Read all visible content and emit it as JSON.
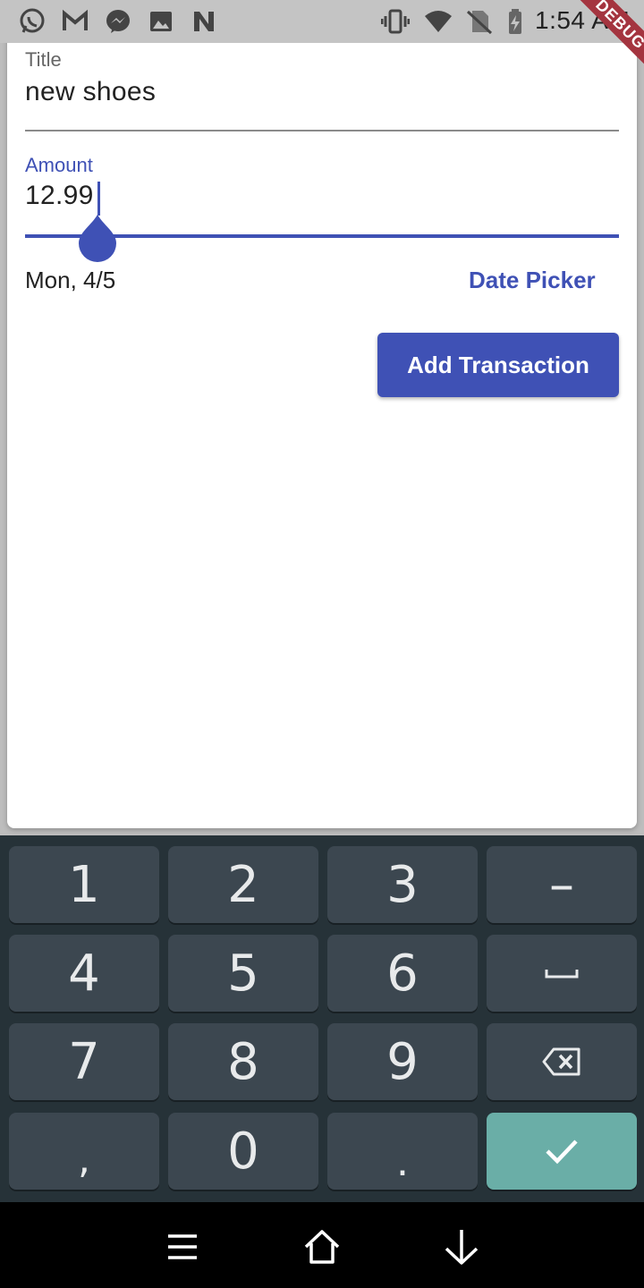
{
  "status_bar": {
    "icons": [
      "whatsapp-icon",
      "gmail-icon",
      "messenger-icon",
      "gallery-icon",
      "n-app-icon",
      "vibrate-icon",
      "wifi-icon",
      "no-sim-icon",
      "battery-icon"
    ],
    "time": "1:54 AM",
    "debug_banner": "DEBUG"
  },
  "form": {
    "title_label": "Title",
    "title_value": "new shoes",
    "amount_label": "Amount",
    "amount_value": "12.99",
    "date_text": "Mon, 4/5",
    "date_picker_label": "Date Picker",
    "submit_label": "Add Transaction"
  },
  "colors": {
    "accent": "#3f51b5",
    "keyboard_bg": "#263238",
    "key_bg": "#3c4750",
    "enter_key": "#6aaea7",
    "debug_ribbon": "#a4343f"
  },
  "keyboard": {
    "keys": [
      {
        "name": "key-1",
        "label": "1"
      },
      {
        "name": "key-2",
        "label": "2"
      },
      {
        "name": "key-3",
        "label": "3"
      },
      {
        "name": "key-minus",
        "label": "–"
      },
      {
        "name": "key-4",
        "label": "4"
      },
      {
        "name": "key-5",
        "label": "5"
      },
      {
        "name": "key-6",
        "label": "6"
      },
      {
        "name": "key-space",
        "label": "",
        "icon": "space-icon"
      },
      {
        "name": "key-7",
        "label": "7"
      },
      {
        "name": "key-8",
        "label": "8"
      },
      {
        "name": "key-9",
        "label": "9"
      },
      {
        "name": "key-backspace",
        "label": "",
        "icon": "backspace-icon"
      },
      {
        "name": "key-comma",
        "label": ","
      },
      {
        "name": "key-0",
        "label": "0"
      },
      {
        "name": "key-period",
        "label": "."
      },
      {
        "name": "key-done",
        "label": "",
        "icon": "checkmark-icon"
      }
    ]
  },
  "nav_bar": {
    "buttons": [
      "menu-icon",
      "home-icon",
      "back-down-icon"
    ]
  }
}
